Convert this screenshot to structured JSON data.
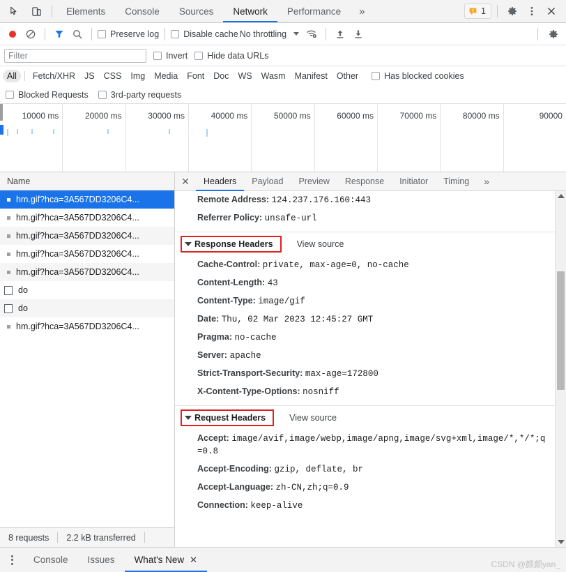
{
  "devtools": {
    "main_tabs": [
      {
        "label": "Elements",
        "active": false
      },
      {
        "label": "Console",
        "active": false
      },
      {
        "label": "Sources",
        "active": false
      },
      {
        "label": "Network",
        "active": true
      },
      {
        "label": "Performance",
        "active": false
      }
    ],
    "more_tabs_glyph": "»",
    "warning_count": "1",
    "icons": {
      "inspect": "inspect-element-icon",
      "device": "device-toolbar-icon",
      "warning": "warning-badge-icon",
      "settings": "gear-icon",
      "menu": "kebab-menu-icon",
      "close": "close-icon"
    }
  },
  "network_toolbar": {
    "record_label": "record-button",
    "clear_label": "clear-button",
    "filter_label": "filter-toggle",
    "search_label": "search-button",
    "preserve_log": "Preserve log",
    "disable_cache": "Disable cache",
    "throttling": "No throttling",
    "wifi_label": "network-conditions-icon",
    "upload_label": "import-har-icon",
    "download_label": "export-har-icon",
    "settings_label": "network-settings-icon"
  },
  "filter_bar": {
    "placeholder": "Filter",
    "value": "",
    "invert": "Invert",
    "hide_data_urls": "Hide data URLs"
  },
  "type_filters": [
    {
      "label": "All",
      "active": true
    },
    {
      "label": "Fetch/XHR",
      "active": false
    },
    {
      "label": "JS",
      "active": false
    },
    {
      "label": "CSS",
      "active": false
    },
    {
      "label": "Img",
      "active": false
    },
    {
      "label": "Media",
      "active": false
    },
    {
      "label": "Font",
      "active": false
    },
    {
      "label": "Doc",
      "active": false
    },
    {
      "label": "WS",
      "active": false
    },
    {
      "label": "Wasm",
      "active": false
    },
    {
      "label": "Manifest",
      "active": false
    },
    {
      "label": "Other",
      "active": false
    }
  ],
  "extra_filters": {
    "has_blocked_cookies": "Has blocked cookies",
    "blocked_requests": "Blocked Requests",
    "third_party": "3rd-party requests"
  },
  "overview": {
    "ticks": [
      "10000 ms",
      "20000 ms",
      "30000 ms",
      "40000 ms",
      "50000 ms",
      "60000 ms",
      "70000 ms",
      "80000 ms",
      "90000"
    ],
    "bars": [
      1.2,
      3.0,
      5.6,
      9.4,
      19.0,
      29.8,
      36.4
    ]
  },
  "request_list": {
    "column_header": "Name",
    "rows": [
      {
        "name": "hm.gif?hca=3A567DD3206C4...",
        "icon": "gif-icon",
        "selected": true
      },
      {
        "name": "hm.gif?hca=3A567DD3206C4...",
        "icon": "gif-icon",
        "selected": false
      },
      {
        "name": "hm.gif?hca=3A567DD3206C4...",
        "icon": "gif-icon",
        "selected": false
      },
      {
        "name": "hm.gif?hca=3A567DD3206C4...",
        "icon": "gif-icon",
        "selected": false
      },
      {
        "name": "hm.gif?hca=3A567DD3206C4...",
        "icon": "gif-icon",
        "selected": false
      },
      {
        "name": "do",
        "icon": "doc-icon",
        "selected": false
      },
      {
        "name": "do",
        "icon": "doc-icon",
        "selected": false
      },
      {
        "name": "hm.gif?hca=3A567DD3206C4...",
        "icon": "gif-icon",
        "selected": false
      }
    ]
  },
  "status_bar": {
    "requests": "8 requests",
    "transferred": "2.2 kB transferred"
  },
  "detail_tabs": [
    {
      "label": "Headers",
      "active": true
    },
    {
      "label": "Payload",
      "active": false
    },
    {
      "label": "Preview",
      "active": false
    },
    {
      "label": "Response",
      "active": false
    },
    {
      "label": "Initiator",
      "active": false
    },
    {
      "label": "Timing",
      "active": false
    }
  ],
  "detail_more_glyph": "»",
  "detail_close_glyph": "✕",
  "headers": {
    "general": [
      {
        "key": "Remote Address:",
        "value": "124.237.176.160:443"
      },
      {
        "key": "Referrer Policy:",
        "value": "unsafe-url"
      }
    ],
    "response_section": {
      "title": "Response Headers",
      "view_source": "View source"
    },
    "response": [
      {
        "key": "Cache-Control:",
        "value": "private, max-age=0, no-cache"
      },
      {
        "key": "Content-Length:",
        "value": "43"
      },
      {
        "key": "Content-Type:",
        "value": "image/gif"
      },
      {
        "key": "Date:",
        "value": "Thu, 02 Mar 2023 12:45:27 GMT"
      },
      {
        "key": "Pragma:",
        "value": "no-cache"
      },
      {
        "key": "Server:",
        "value": "apache"
      },
      {
        "key": "Strict-Transport-Security:",
        "value": "max-age=172800"
      },
      {
        "key": "X-Content-Type-Options:",
        "value": "nosniff"
      }
    ],
    "request_section": {
      "title": "Request Headers",
      "view_source": "View source"
    },
    "request": [
      {
        "key": "Accept:",
        "value": "image/avif,image/webp,image/apng,image/svg+xml,image/*,*/*;q=0.8"
      },
      {
        "key": "Accept-Encoding:",
        "value": "gzip, deflate, br"
      },
      {
        "key": "Accept-Language:",
        "value": "zh-CN,zh;q=0.9"
      },
      {
        "key": "Connection:",
        "value": "keep-alive"
      }
    ]
  },
  "drawer": {
    "tabs": [
      {
        "label": "Console",
        "active": false,
        "closable": false
      },
      {
        "label": "Issues",
        "active": false,
        "closable": false
      },
      {
        "label": "What's New",
        "active": true,
        "closable": true
      }
    ],
    "close_glyph": "✕"
  },
  "watermark": "CSDN @颜颜yan_",
  "colors": {
    "accent": "#1a73e8",
    "selection": "#1a73e8",
    "record": "#e63329",
    "annotation": "#e02020",
    "warning": "#f5a623"
  }
}
